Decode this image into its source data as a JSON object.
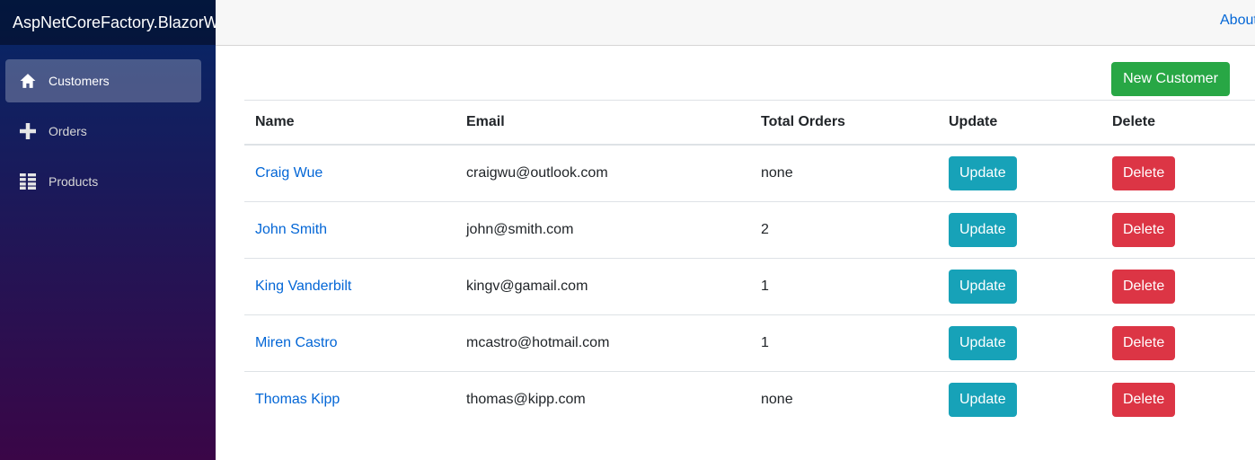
{
  "sidebar": {
    "brand": "AspNetCoreFactory.BlazorWe",
    "items": [
      {
        "label": "Customers",
        "icon": "home-icon",
        "active": true
      },
      {
        "label": "Orders",
        "icon": "plus-icon",
        "active": false
      },
      {
        "label": "Products",
        "icon": "list-icon",
        "active": false
      }
    ]
  },
  "top_row": {
    "about": "About"
  },
  "toolbar": {
    "new_customer_label": "New Customer"
  },
  "table": {
    "columns": [
      "Name",
      "Email",
      "Total Orders",
      "Update",
      "Delete"
    ],
    "rows": [
      {
        "name": "Craig Wue",
        "email": "craigwu@outlook.com",
        "total_orders": "none",
        "update": "Update",
        "delete": "Delete"
      },
      {
        "name": "John Smith",
        "email": "john@smith.com",
        "total_orders": "2",
        "update": "Update",
        "delete": "Delete"
      },
      {
        "name": "King Vanderbilt",
        "email": "kingv@gamail.com",
        "total_orders": "1",
        "update": "Update",
        "delete": "Delete"
      },
      {
        "name": "Miren Castro",
        "email": "mcastro@hotmail.com",
        "total_orders": "1",
        "update": "Update",
        "delete": "Delete"
      },
      {
        "name": "Thomas Kipp",
        "email": "thomas@kipp.com",
        "total_orders": "none",
        "update": "Update",
        "delete": "Delete"
      }
    ]
  },
  "colors": {
    "success": "#28a745",
    "info": "#17a2b8",
    "danger": "#dc3545",
    "link": "#0366d6"
  }
}
